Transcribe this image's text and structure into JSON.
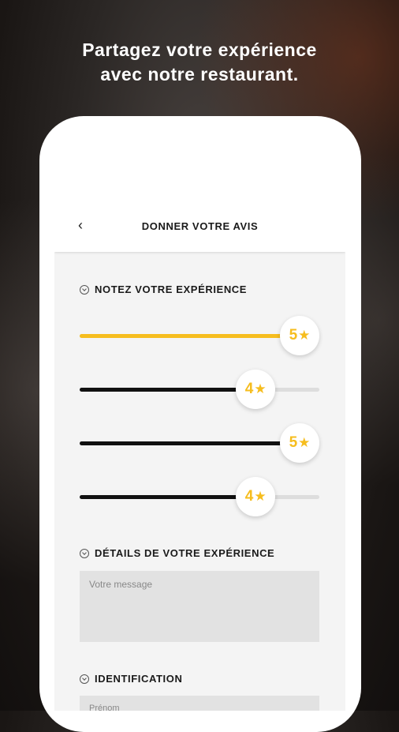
{
  "headline": {
    "line1": "Partagez votre expérience",
    "line2": "avec notre restaurant."
  },
  "appbar": {
    "back_icon": "chevron-left-icon",
    "back_glyph": "‹",
    "title": "DONNER VOTRE AVIS"
  },
  "rating_section": {
    "title": "NOTEZ VOTRE EXPÉRIENCE",
    "max": 5,
    "star_glyph": "★",
    "sliders": [
      {
        "value": "5",
        "rating": 5,
        "fill_color": "#f6bd1e"
      },
      {
        "value": "4",
        "rating": 4,
        "fill_color": "#111111"
      },
      {
        "value": "5",
        "rating": 5,
        "fill_color": "#111111"
      },
      {
        "value": "4",
        "rating": 4,
        "fill_color": "#111111"
      }
    ]
  },
  "details_section": {
    "title": "DÉTAILS DE VOTRE EXPÉRIENCE",
    "message_placeholder": "Votre message"
  },
  "identification_section": {
    "title": "IDENTIFICATION",
    "firstname_placeholder": "Prénom"
  },
  "colors": {
    "accent": "#f6bd1e",
    "track": "#dddddd",
    "screen_bg": "#f4f4f4"
  }
}
